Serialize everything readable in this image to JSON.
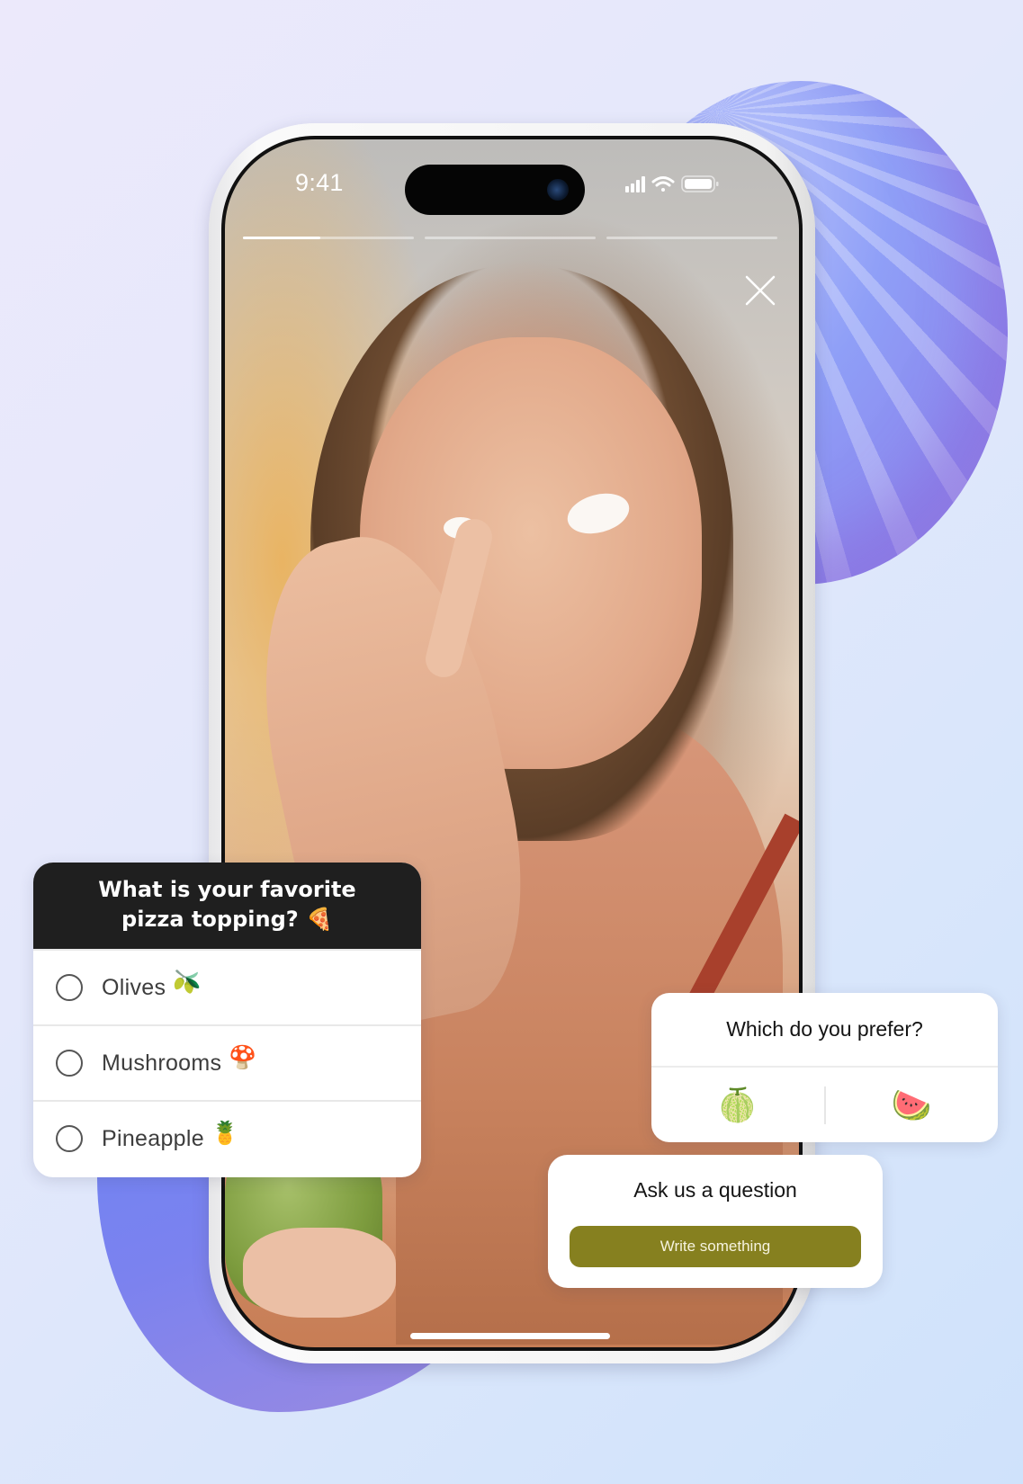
{
  "status_bar": {
    "time": "9:41",
    "icons": [
      "signal-icon",
      "wifi-icon",
      "battery-icon"
    ]
  },
  "story": {
    "segments": [
      {
        "progress": 0.45
      },
      {
        "progress": 0
      },
      {
        "progress": 0
      }
    ],
    "close_icon": "close-icon",
    "image_description": "Smiling woman applying face cream to her nose, holding a green jar"
  },
  "poll": {
    "question_line1": "What is your favorite",
    "question_line2": "pizza topping?",
    "question_emoji": "🍕",
    "options": [
      {
        "label": "Olives",
        "emoji": "🫒"
      },
      {
        "label": "Mushrooms",
        "emoji": "🍄"
      },
      {
        "label": "Pineapple",
        "emoji": "🍍"
      }
    ]
  },
  "prefer": {
    "title": "Which do you prefer?",
    "options": [
      {
        "emoji": "🍈",
        "name": "melon"
      },
      {
        "emoji": "🍉",
        "name": "watermelon"
      }
    ]
  },
  "ask": {
    "title": "Ask us a question",
    "button_label": "Write something",
    "button_color": "#86801f"
  },
  "colors": {
    "poll_header_bg": "#1f1f1f",
    "background_start": "#ece9fb",
    "background_end": "#cfe2fb",
    "accent_purple": "#8b86ee"
  }
}
